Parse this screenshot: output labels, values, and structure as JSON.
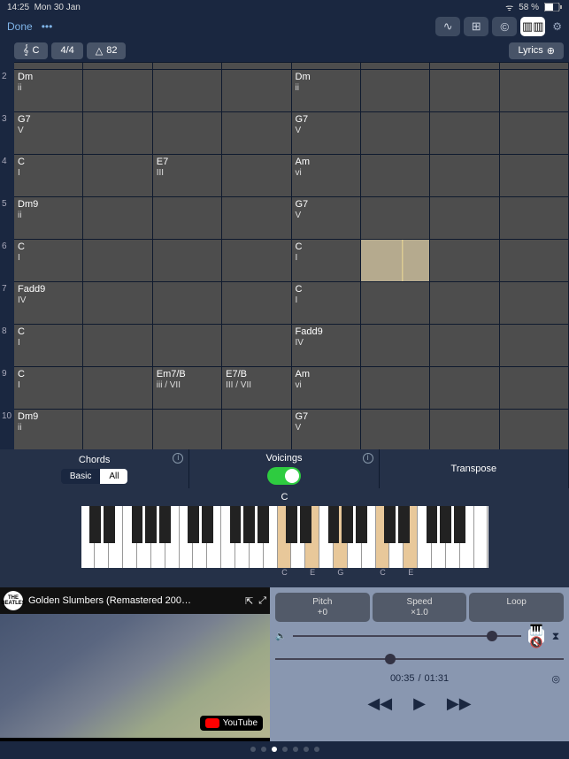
{
  "statusbar": {
    "time": "14:25",
    "date": "Mon 30 Jan",
    "battery": "58 %",
    "wifi": "􀙇"
  },
  "appbar": {
    "done": "Done",
    "more": "•••"
  },
  "toolbar": {
    "key": "C",
    "sig": "4/4",
    "tempo": "82",
    "lyrics": "Lyrics"
  },
  "rows": [
    {
      "n": 2,
      "c": [
        {
          "name": "Dm",
          "f": "ii"
        },
        {},
        {},
        {},
        {
          "name": "Dm",
          "f": "ii"
        },
        {},
        {},
        {}
      ]
    },
    {
      "n": 3,
      "c": [
        {
          "name": "G7",
          "f": "V"
        },
        {},
        {},
        {},
        {
          "name": "G7",
          "f": "V"
        },
        {},
        {},
        {}
      ]
    },
    {
      "n": 4,
      "c": [
        {
          "name": "C",
          "f": "I"
        },
        {},
        {
          "name": "E7",
          "f": "III"
        },
        {},
        {
          "name": "Am",
          "f": "vi"
        },
        {},
        {},
        {}
      ]
    },
    {
      "n": 5,
      "c": [
        {
          "name": "Dm9",
          "f": "ii"
        },
        {},
        {},
        {},
        {
          "name": "G7",
          "f": "V"
        },
        {},
        {},
        {}
      ]
    },
    {
      "n": 6,
      "c": [
        {
          "name": "C",
          "f": "I"
        },
        {},
        {},
        {},
        {
          "name": "C",
          "f": "I"
        },
        {
          "hl": true
        },
        {},
        {}
      ]
    },
    {
      "n": 7,
      "c": [
        {
          "name": "Fadd9",
          "f": "IV"
        },
        {},
        {},
        {},
        {
          "name": "C",
          "f": "I"
        },
        {},
        {},
        {}
      ]
    },
    {
      "n": 8,
      "c": [
        {
          "name": "C",
          "f": "I"
        },
        {},
        {},
        {},
        {
          "name": "Fadd9",
          "f": "IV"
        },
        {},
        {},
        {}
      ]
    },
    {
      "n": 9,
      "c": [
        {
          "name": "C",
          "f": "I"
        },
        {},
        {
          "name": "Em7/B",
          "f": "iii / VII"
        },
        {
          "name": "E7/B",
          "f": "III / VII"
        },
        {
          "name": "Am",
          "f": "vi"
        },
        {},
        {},
        {}
      ]
    },
    {
      "n": 10,
      "c": [
        {
          "name": "Dm9",
          "f": "ii"
        },
        {},
        {},
        {},
        {
          "name": "G7",
          "f": "V"
        },
        {},
        {},
        {}
      ]
    }
  ],
  "controls": {
    "chords": "Chords",
    "basic": "Basic",
    "all": "All",
    "voicings": "Voicings",
    "transpose": "Transpose",
    "pianoKey": "C"
  },
  "pressed": [
    14,
    16,
    18,
    21,
    23
  ],
  "noteLabels": [
    "",
    "",
    "",
    "",
    "",
    "",
    "",
    "",
    "",
    "",
    "",
    "",
    "",
    "",
    "C",
    "",
    "E",
    "",
    "G",
    "",
    "",
    "C",
    "",
    "E",
    "",
    "",
    "",
    "",
    ""
  ],
  "blackKeys": [
    0,
    1,
    3,
    4,
    5,
    7,
    8,
    10,
    11,
    12,
    14,
    15,
    17,
    18,
    19,
    21,
    22,
    24,
    25,
    26
  ],
  "video": {
    "title": "Golden Slumbers (Remastered 200…",
    "badge": "YouTube",
    "channel": "BEATLES"
  },
  "player": {
    "pitch": "Pitch",
    "pitchVal": "+0",
    "speed": "Speed",
    "speedVal": "×1.0",
    "loop": "Loop",
    "elapsed": "00:35",
    "total": "01:31",
    "vol": 0.85,
    "seek": 0.38
  }
}
